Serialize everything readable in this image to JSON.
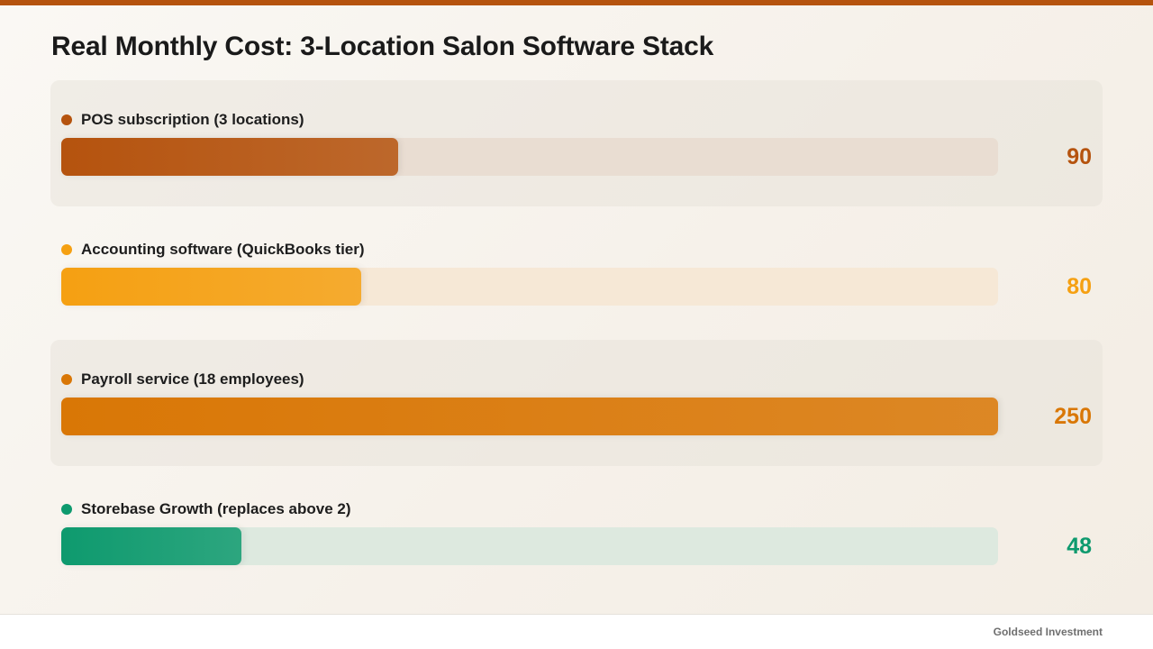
{
  "chart_data": {
    "type": "bar",
    "orientation": "horizontal",
    "title": "Real Monthly Cost: 3-Location Salon Software Stack",
    "xlim": [
      0,
      250
    ],
    "grid": false,
    "legend": "none",
    "categories": [
      "POS subscription (3 locations)",
      "Accounting software (QuickBooks tier)",
      "Payroll service (18 employees)",
      "Storebase Growth (replaces above 2)"
    ],
    "values": [
      90,
      80,
      250,
      48
    ],
    "colors": [
      "#b5530e",
      "#f5a012",
      "#d97706",
      "#0e9a6e"
    ],
    "track_colors": [
      "#e9ddd2",
      "#f6e8d6",
      "#f2e4d4",
      "#dde9df"
    ]
  },
  "footer": {
    "brand": "Goldseed Investment"
  }
}
